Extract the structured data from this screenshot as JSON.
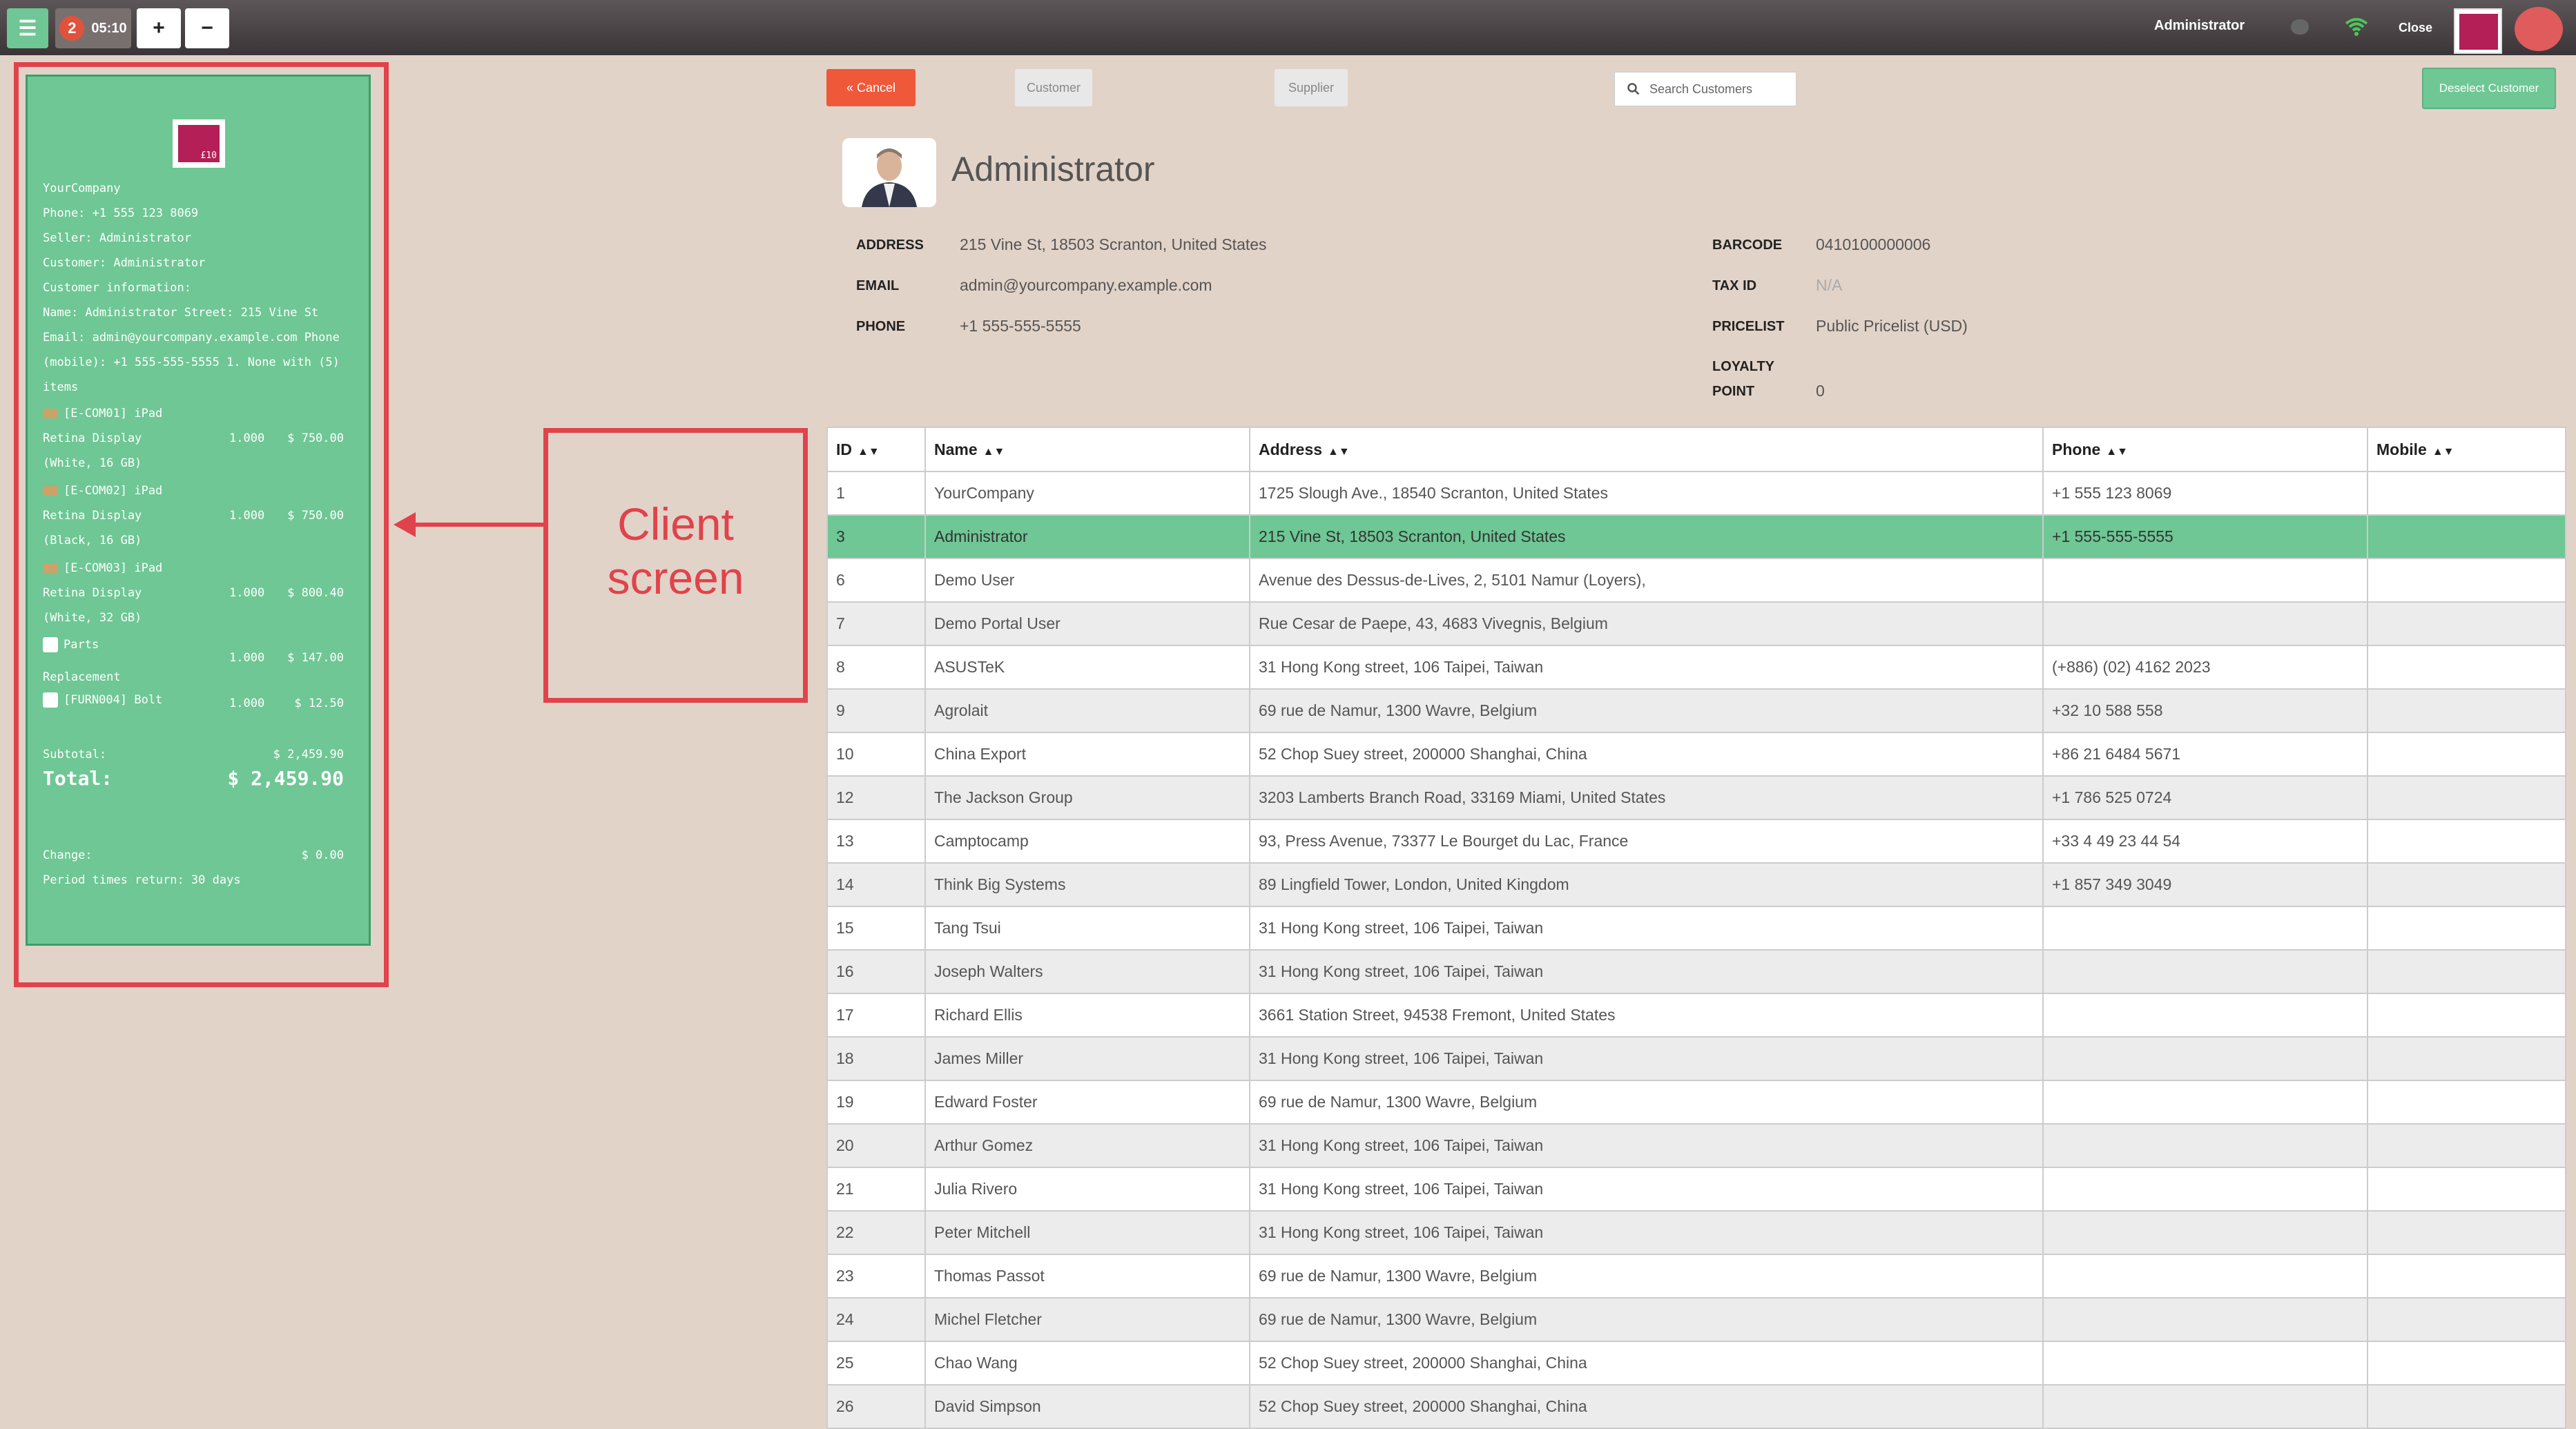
{
  "topbar": {
    "order_count": "2",
    "order_time": "05:10",
    "plus": "+",
    "minus": "−",
    "user": "Administrator",
    "close": "Close"
  },
  "receipt": {
    "logo_text": "£10",
    "lines": [
      "YourCompany",
      "Phone: +1 555 123 8069",
      "Seller: Administrator",
      "Customer: Administrator",
      "Customer information:",
      "Name: Administrator Street: 215 Vine St",
      "Email: admin@yourcompany.example.com Phone",
      "(mobile): +1 555-555-5555 1. None with (5)",
      "items"
    ],
    "items": [
      {
        "name1": "[E-COM01] iPad",
        "name2": "Retina Display",
        "name3": "(White, 16 GB)",
        "qty": "1.000",
        "price": "$ 750.00"
      },
      {
        "name1": "[E-COM02] iPad",
        "name2": "Retina Display",
        "name3": "(Black, 16 GB)",
        "qty": "1.000",
        "price": "$ 750.00"
      },
      {
        "name1": "[E-COM03] iPad",
        "name2": "Retina Display",
        "name3": "(White, 32 GB)",
        "qty": "1.000",
        "price": "$ 800.40"
      },
      {
        "name1": "Parts",
        "name2": "Replacement",
        "name3": "",
        "qty": "1.000",
        "price": "$ 147.00"
      },
      {
        "name1": "[FURN004] Bolt",
        "name2": "",
        "name3": "",
        "qty": "1.000",
        "price": "$ 12.50"
      }
    ],
    "subtotal_label": "Subtotal:",
    "subtotal": "$ 2,459.90",
    "total_label": "Total:",
    "total": "$ 2,459.90",
    "change_label": "Change:",
    "change": "$ 0.00",
    "return_period": "Period times return: 30 days"
  },
  "annotation": {
    "label_line1": "Client",
    "label_line2": "screen"
  },
  "actions": {
    "cancel": "« Cancel",
    "customer": "Customer",
    "supplier": "Supplier",
    "search_placeholder": "Search Customers",
    "deselect": "Deselect Customer"
  },
  "customer": {
    "name": "Administrator",
    "address_label": "ADDRESS",
    "address": "215 Vine St, 18503 Scranton, United States",
    "email_label": "EMAIL",
    "email": "admin@yourcompany.example.com",
    "phone_label": "PHONE",
    "phone": "+1 555-555-5555",
    "barcode_label": "BARCODE",
    "barcode": "0410100000006",
    "taxid_label": "TAX ID",
    "taxid": "N/A",
    "pricelist_label": "PRICELIST",
    "pricelist": "Public Pricelist (USD)",
    "loyalty_label1": "LOYALTY",
    "loyalty_label2": "POINT",
    "loyalty": "0"
  },
  "table": {
    "headers": [
      "ID",
      "Name",
      "Address",
      "Phone",
      "Mobile"
    ],
    "rows": [
      [
        "1",
        "YourCompany",
        "1725 Slough Ave., 18540 Scranton, United States",
        "+1 555 123 8069",
        ""
      ],
      [
        "3",
        "Administrator",
        "215 Vine St, 18503 Scranton, United States",
        "+1 555-555-5555",
        ""
      ],
      [
        "6",
        "Demo User",
        "Avenue des Dessus-de-Lives, 2, 5101 Namur (Loyers),",
        "",
        ""
      ],
      [
        "7",
        "Demo Portal User",
        "Rue Cesar de Paepe, 43, 4683 Vivegnis, Belgium",
        "",
        ""
      ],
      [
        "8",
        "ASUSTeK",
        "31 Hong Kong street, 106 Taipei, Taiwan",
        "(+886) (02) 4162 2023",
        ""
      ],
      [
        "9",
        "Agrolait",
        "69 rue de Namur, 1300 Wavre, Belgium",
        "+32 10 588 558",
        ""
      ],
      [
        "10",
        "China Export",
        "52 Chop Suey street, 200000 Shanghai, China",
        "+86 21 6484 5671",
        ""
      ],
      [
        "12",
        "The Jackson Group",
        "3203 Lamberts Branch Road, 33169 Miami, United States",
        "+1 786 525 0724",
        ""
      ],
      [
        "13",
        "Camptocamp",
        "93, Press Avenue, 73377 Le Bourget du Lac, France",
        "+33 4 49 23 44 54",
        ""
      ],
      [
        "14",
        "Think Big Systems",
        "89 Lingfield Tower, London, United Kingdom",
        "+1 857 349 3049",
        ""
      ],
      [
        "15",
        "Tang Tsui",
        "31 Hong Kong street, 106 Taipei, Taiwan",
        "",
        ""
      ],
      [
        "16",
        "Joseph Walters",
        "31 Hong Kong street, 106 Taipei, Taiwan",
        "",
        ""
      ],
      [
        "17",
        "Richard Ellis",
        "3661 Station Street, 94538 Fremont, United States",
        "",
        ""
      ],
      [
        "18",
        "James Miller",
        "31 Hong Kong street, 106 Taipei, Taiwan",
        "",
        ""
      ],
      [
        "19",
        "Edward Foster",
        "69 rue de Namur, 1300 Wavre, Belgium",
        "",
        ""
      ],
      [
        "20",
        "Arthur Gomez",
        "31 Hong Kong street, 106 Taipei, Taiwan",
        "",
        ""
      ],
      [
        "21",
        "Julia Rivero",
        "31 Hong Kong street, 106 Taipei, Taiwan",
        "",
        ""
      ],
      [
        "22",
        "Peter Mitchell",
        "31 Hong Kong street, 106 Taipei, Taiwan",
        "",
        ""
      ],
      [
        "23",
        "Thomas Passot",
        "69 rue de Namur, 1300 Wavre, Belgium",
        "",
        ""
      ],
      [
        "24",
        "Michel Fletcher",
        "69 rue de Namur, 1300 Wavre, Belgium",
        "",
        ""
      ],
      [
        "25",
        "Chao Wang",
        "52 Chop Suey street, 200000 Shanghai, China",
        "",
        ""
      ],
      [
        "26",
        "David Simpson",
        "52 Chop Suey street, 200000 Shanghai, China",
        "",
        ""
      ]
    ],
    "selected_id": "3"
  }
}
